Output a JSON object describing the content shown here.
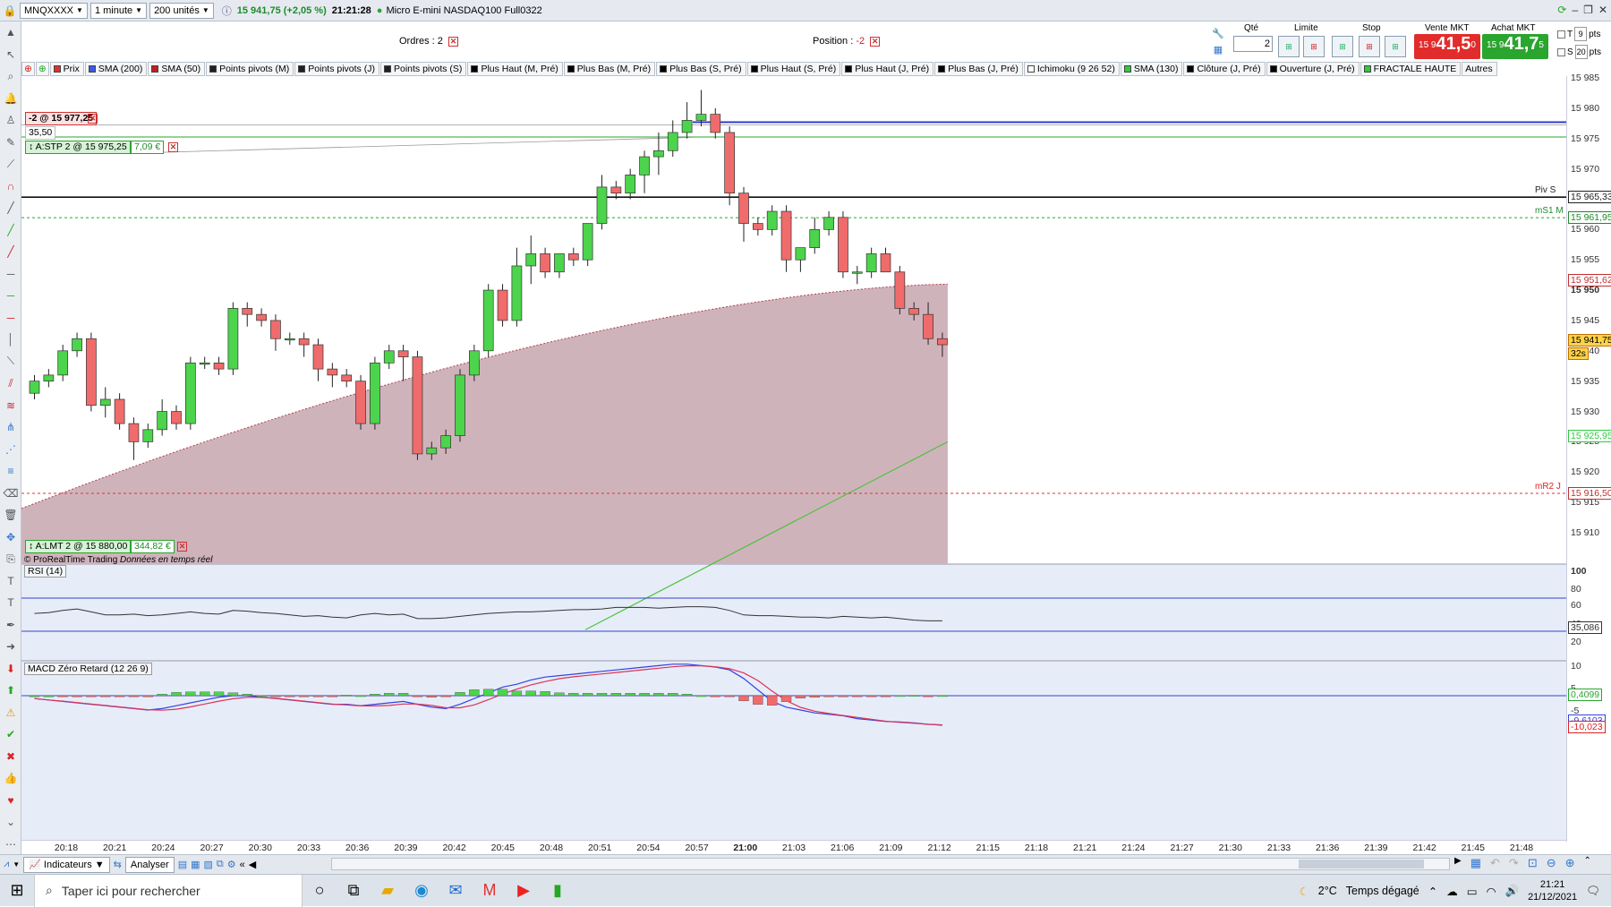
{
  "top_bar": {
    "symbol": "MNQXXXX",
    "timeframe": "1 minute",
    "units": "200 unités",
    "price_change": "15 941,75 (+2,05 %)",
    "time": "21:21:28",
    "instrument": "Micro E-mini NASDAQ100 Full0322"
  },
  "orders": {
    "label": "Ordres :",
    "value": "2"
  },
  "position": {
    "label": "Position :",
    "value": "-2"
  },
  "order_panel": {
    "qty_label": "Qté",
    "qty_value": "2",
    "limit_label": "Limite",
    "stop_label": "Stop",
    "sell_label": "Vente MKT",
    "buy_label": "Achat MKT",
    "sell_small": "15 9",
    "sell_big": "41,5",
    "sell_sup": "0",
    "buy_small": "15 9",
    "buy_big": "41,7",
    "buy_sup": "5",
    "t_label": "T",
    "t_value": "9",
    "s_label": "S",
    "s_value": "20",
    "pts": "pts"
  },
  "indicators": [
    {
      "label": "Prix",
      "color": "#e03030"
    },
    {
      "label": "SMA (200)",
      "color": "#3a5ae0"
    },
    {
      "label": "SMA (50)",
      "color": "#c02020"
    },
    {
      "label": "Points pivots (M)",
      "color": "#202020"
    },
    {
      "label": "Points pivots (J)",
      "color": "#202020"
    },
    {
      "label": "Points pivots (S)",
      "color": "#202020"
    },
    {
      "label": "Plus Haut (M, Pré)",
      "color": "#000000"
    },
    {
      "label": "Plus Bas (M, Pré)",
      "color": "#000000"
    },
    {
      "label": "Plus Bas (S, Pré)",
      "color": "#000000"
    },
    {
      "label": "Plus Haut (S, Pré)",
      "color": "#000000"
    },
    {
      "label": "Plus Haut (J, Pré)",
      "color": "#000000"
    },
    {
      "label": "Plus Bas (J, Pré)",
      "color": "#000000"
    },
    {
      "label": "Ichimoku (9 26 52)",
      "color": "#ffffff"
    },
    {
      "label": "SMA (130)",
      "color": "#2ecc40"
    },
    {
      "label": "Clôture (J, Pré)",
      "color": "#000000"
    },
    {
      "label": "Ouverture (J, Pré)",
      "color": "#000000"
    },
    {
      "label": "FRACTALE HAUTE",
      "color": "#2ecc40"
    },
    {
      "label": "Autres",
      "color": ""
    }
  ],
  "chart_data": {
    "type": "candlestick",
    "price_ticks": [
      "15 985",
      "15 980",
      "15 975",
      "15 970",
      "15 960",
      "15 955",
      "15 950",
      "15 945",
      "15 940",
      "15 935",
      "15 930",
      "15 925",
      "15 920",
      "15 915",
      "15 910"
    ],
    "tags": [
      {
        "text": "15 965,33",
        "color": "#222222"
      },
      {
        "text": "15 961,95",
        "color": "#1e8b2b"
      },
      {
        "text": "15 951,62",
        "color": "#c03030"
      },
      {
        "text": "15 941,75",
        "color": "#c07000"
      },
      {
        "text": "32s",
        "color": "#c07000"
      },
      {
        "text": "15 925,95",
        "color": "#2ecc40"
      },
      {
        "text": "15 916,50",
        "color": "#c03030"
      }
    ],
    "line_labels": {
      "pivs": "Piv S",
      "ms1": "mS1 M",
      "mr2": "mR2 J"
    },
    "candles": [
      [
        15933,
        15936,
        15932,
        15935
      ],
      [
        15935,
        15937,
        15934,
        15936
      ],
      [
        15936,
        15941,
        15935,
        15940
      ],
      [
        15940,
        15943,
        15939,
        15942
      ],
      [
        15942,
        15943,
        15930,
        15931
      ],
      [
        15931,
        15934,
        15929,
        15932
      ],
      [
        15932,
        15933,
        15927,
        15928
      ],
      [
        15928,
        15929,
        15922,
        15925
      ],
      [
        15925,
        15928,
        15924,
        15927
      ],
      [
        15927,
        15932,
        15926,
        15930
      ],
      [
        15930,
        15931,
        15927,
        15928
      ],
      [
        15928,
        15939,
        15927,
        15938
      ],
      [
        15938,
        15939,
        15937,
        15938
      ],
      [
        15938,
        15939,
        15936,
        15937
      ],
      [
        15937,
        15948,
        15936,
        15947
      ],
      [
        15947,
        15948,
        15944,
        15946
      ],
      [
        15946,
        15947,
        15944,
        15945
      ],
      [
        15945,
        15946,
        15940,
        15942
      ],
      [
        15942,
        15943,
        15941,
        15942
      ],
      [
        15942,
        15943,
        15939,
        15941
      ],
      [
        15941,
        15942,
        15935,
        15937
      ],
      [
        15937,
        15938,
        15934,
        15936
      ],
      [
        15936,
        15937,
        15934,
        15935
      ],
      [
        15935,
        15936,
        15927,
        15928
      ],
      [
        15928,
        15939,
        15927,
        15938
      ],
      [
        15938,
        15941,
        15937,
        15940
      ],
      [
        15940,
        15941,
        15935,
        15939
      ],
      [
        15939,
        15940,
        15922,
        15923
      ],
      [
        15923,
        15925,
        15922,
        15924
      ],
      [
        15924,
        15927,
        15923,
        15926
      ],
      [
        15926,
        15937,
        15925,
        15936
      ],
      [
        15936,
        15941,
        15935,
        15940
      ],
      [
        15940,
        15951,
        15939,
        15950
      ],
      [
        15950,
        15951,
        15944,
        15945
      ],
      [
        15945,
        15957,
        15944,
        15954
      ],
      [
        15954,
        15959,
        15951,
        15956
      ],
      [
        15956,
        15957,
        15952,
        15953
      ],
      [
        15953,
        15955,
        15952,
        15956
      ],
      [
        15956,
        15957,
        15954,
        15955
      ],
      [
        15955,
        15961,
        15954,
        15961
      ],
      [
        15961,
        15969,
        15960,
        15967
      ],
      [
        15967,
        15968,
        15965,
        15966
      ],
      [
        15966,
        15970,
        15965,
        15969
      ],
      [
        15969,
        15973,
        15966,
        15972
      ],
      [
        15972,
        15976,
        15969,
        15973
      ],
      [
        15973,
        15978,
        15972,
        15976
      ],
      [
        15976,
        15981,
        15975,
        15978
      ],
      [
        15978,
        15983,
        15977,
        15979
      ],
      [
        15979,
        15980,
        15975,
        15976
      ],
      [
        15976,
        15977,
        15964,
        15966
      ],
      [
        15966,
        15967,
        15958,
        15961
      ],
      [
        15961,
        15962,
        15959,
        15960
      ],
      [
        15960,
        15964,
        15959,
        15963
      ],
      [
        15963,
        15964,
        15953,
        15955
      ],
      [
        15955,
        15956,
        15953,
        15957
      ],
      [
        15957,
        15962,
        15956,
        15960
      ],
      [
        15960,
        15963,
        15959,
        15962
      ],
      [
        15962,
        15963,
        15952,
        15953
      ],
      [
        15953,
        15954,
        15951,
        15953
      ],
      [
        15953,
        15957,
        15952,
        15956
      ],
      [
        15956,
        15957,
        15953,
        15953
      ],
      [
        15953,
        15954,
        15946,
        15947
      ],
      [
        15947,
        15948,
        15945,
        15946
      ],
      [
        15946,
        15948,
        15941,
        15942
      ],
      [
        15942,
        15943,
        15939,
        15941
      ]
    ],
    "sma_red_start": 15914,
    "sma_red_end": 15951,
    "sma_green_start": 15894,
    "sma_green_end": 15925
  },
  "rsi": {
    "label": "RSI (14)",
    "ticks": [
      "100",
      "80",
      "60",
      "40",
      "20"
    ],
    "tag": "35,086"
  },
  "macd": {
    "label": "MACD Zéro Retard (12 26 9)",
    "ticks": [
      "10",
      "5",
      "-5"
    ],
    "tag_green": "0,4099",
    "tag_blue": "-9,6103",
    "tag_red": "-10,023"
  },
  "watermark": {
    "brand": "© ProRealTime Trading",
    "feed": "Données en temps réel"
  },
  "order_tags": {
    "position": "-2 @ 15 977,25",
    "position_pl": "35,50",
    "stop_order": "A:STP 2 @ 15 975,25",
    "stop_value": "7,09 €",
    "limit_order": "A:LMT 2 @ 15 880,00",
    "limit_value": "344,82 €"
  },
  "time_ticks": [
    "20:18",
    "20:21",
    "20:24",
    "20:27",
    "20:30",
    "20:33",
    "20:36",
    "20:39",
    "20:42",
    "20:45",
    "20:48",
    "20:51",
    "20:54",
    "20:57",
    "21:00",
    "21:03",
    "21:06",
    "21:09",
    "21:12",
    "21:15",
    "21:18",
    "21:21",
    "21:24",
    "21:27",
    "21:30",
    "21:33",
    "21:36",
    "21:39",
    "21:42",
    "21:45",
    "21:48"
  ],
  "bottom_toolbar": {
    "indicators": "Indicateurs",
    "analyse": "Analyser"
  },
  "taskbar": {
    "search": "Taper ici pour rechercher",
    "temperature": "2°C",
    "weather": "Temps dégagé",
    "time": "21:21",
    "date": "21/12/2021"
  }
}
